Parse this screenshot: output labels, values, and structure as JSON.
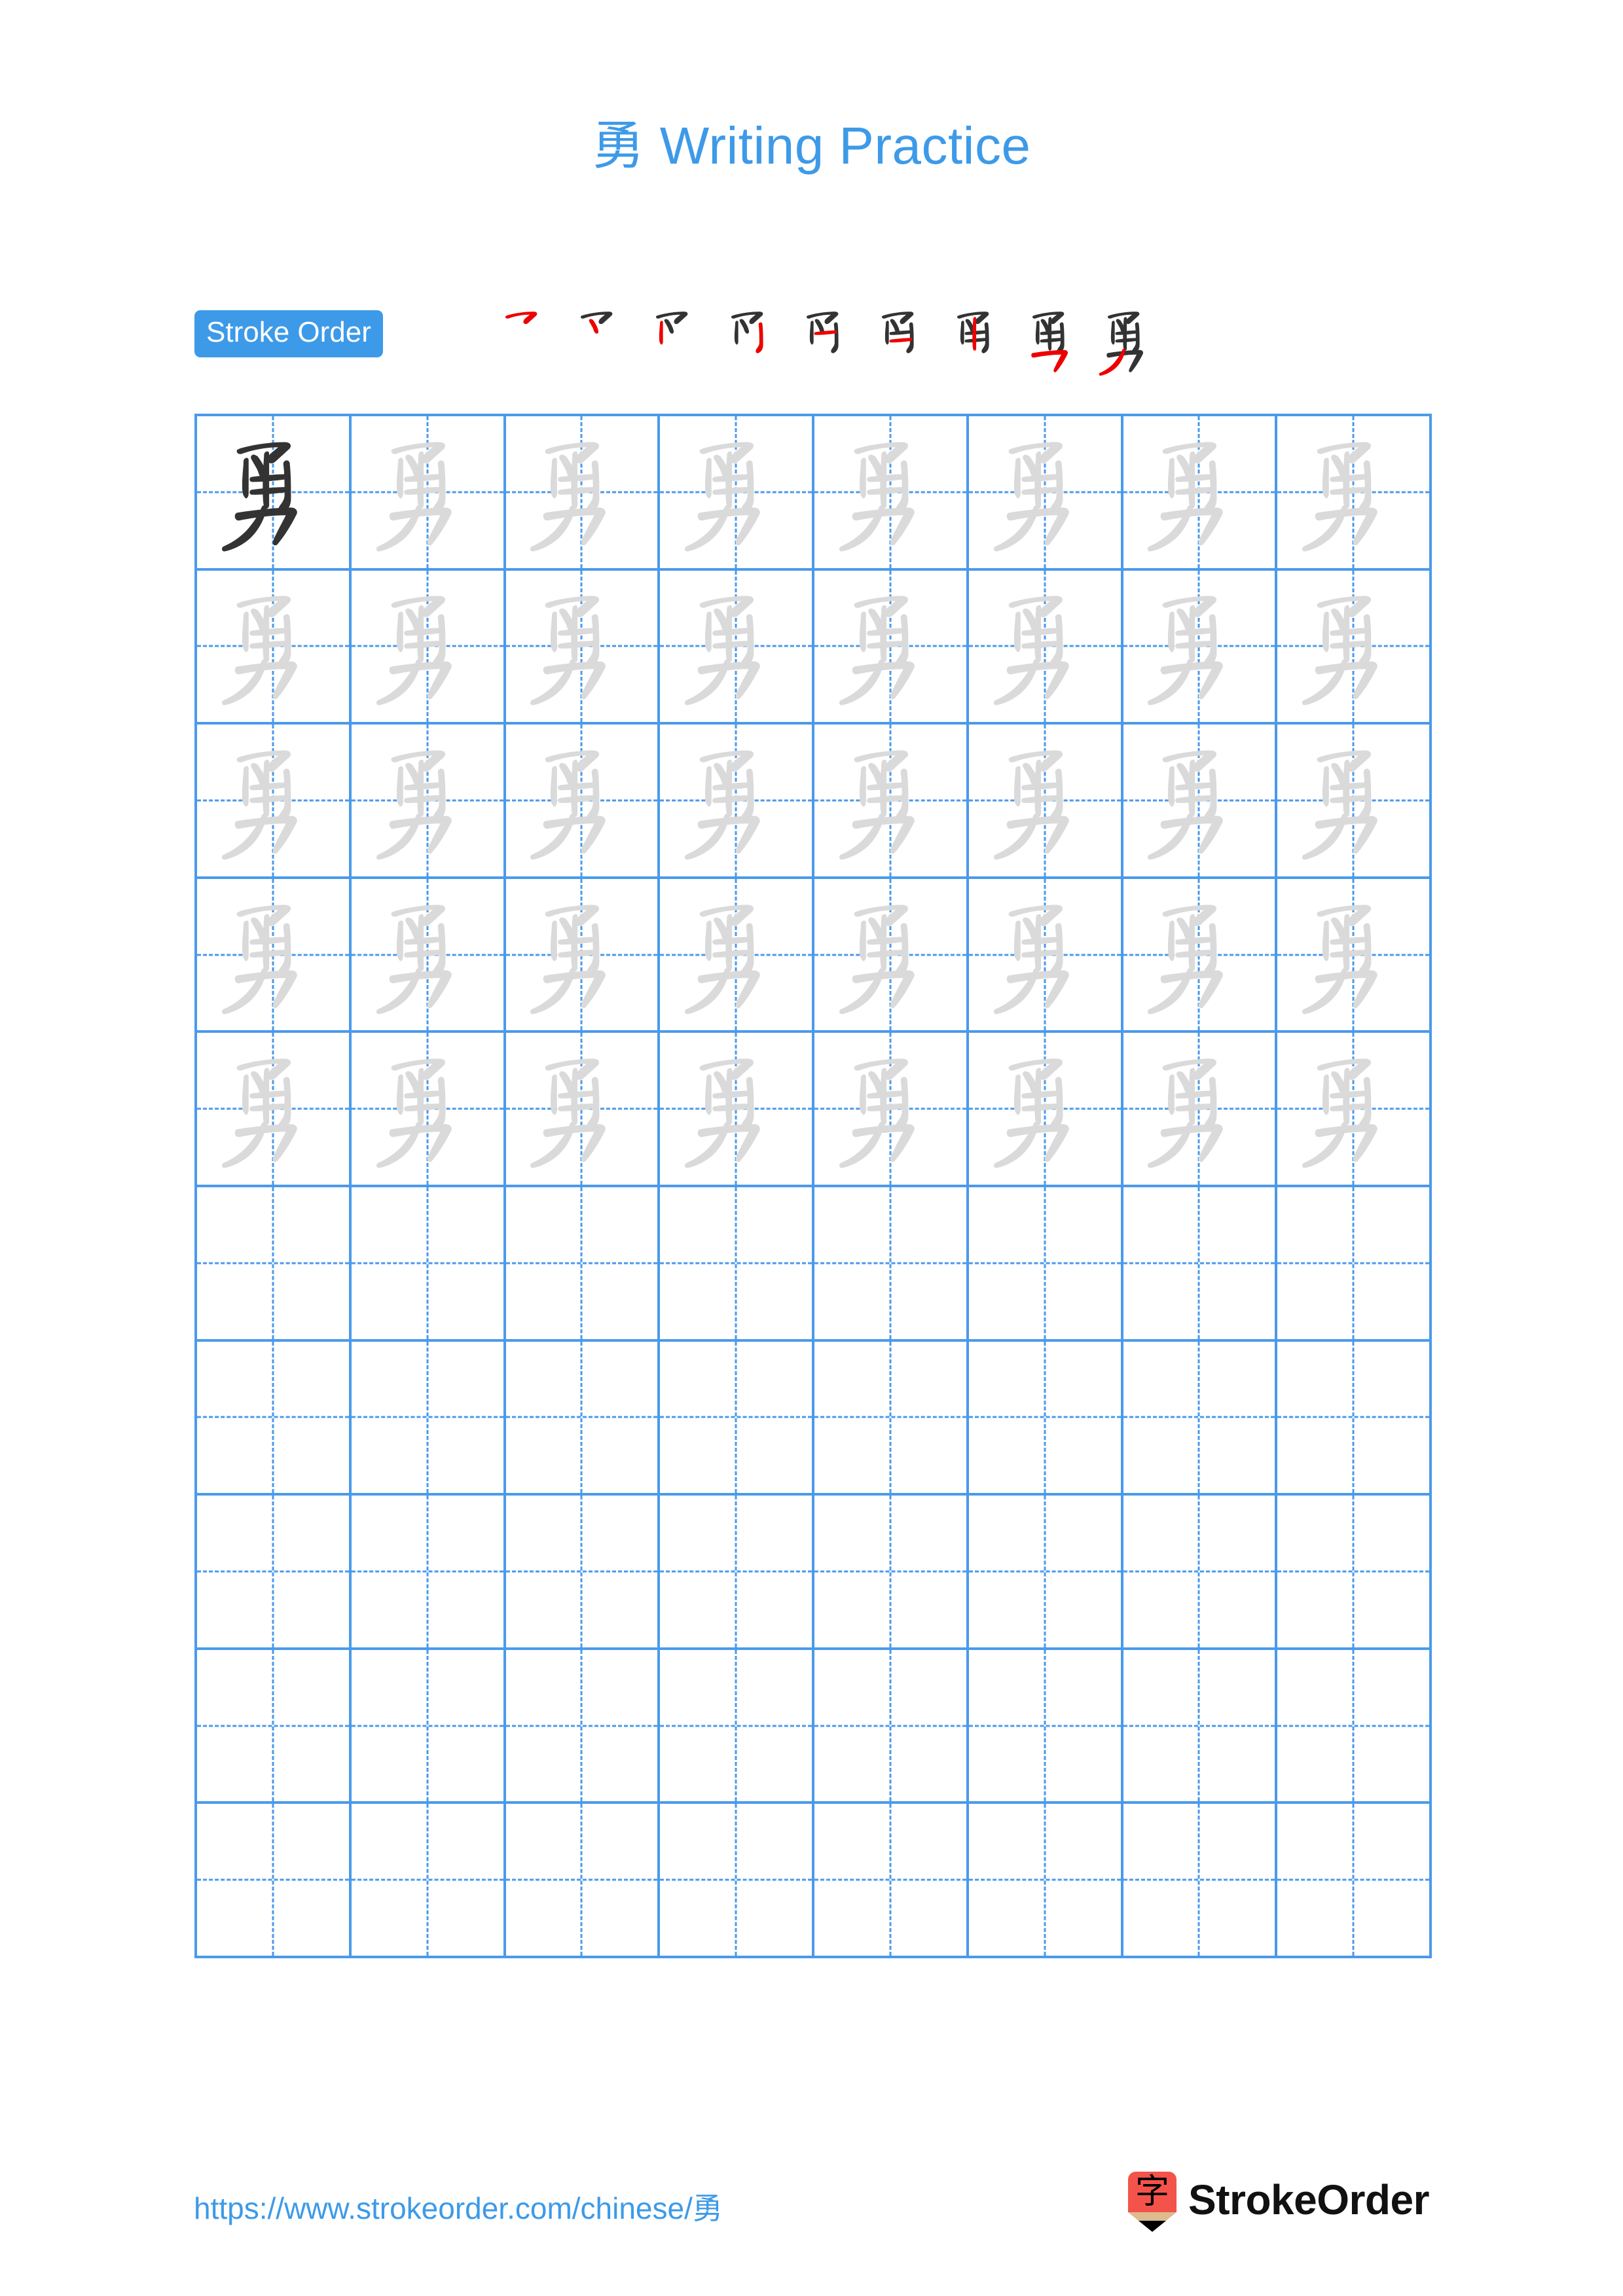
{
  "page": {
    "character": "勇",
    "title_suffix": " Writing Practice",
    "accent_color": "#3d9ae8",
    "grid_line_color": "#4a9aeb",
    "trace_color": "#dadada",
    "model_color": "#333333",
    "stroke_highlight_color": "#ee0000",
    "stroke_done_color": "#333333"
  },
  "stroke_order": {
    "badge_label": "Stroke Order",
    "total_strokes": 9,
    "steps": [
      {
        "index": 1,
        "strokes_shown": 1
      },
      {
        "index": 2,
        "strokes_shown": 2
      },
      {
        "index": 3,
        "strokes_shown": 3
      },
      {
        "index": 4,
        "strokes_shown": 4
      },
      {
        "index": 5,
        "strokes_shown": 5
      },
      {
        "index": 6,
        "strokes_shown": 6
      },
      {
        "index": 7,
        "strokes_shown": 7
      },
      {
        "index": 8,
        "strokes_shown": 8
      },
      {
        "index": 9,
        "strokes_shown": 9
      }
    ]
  },
  "grid": {
    "columns": 8,
    "rows": 10,
    "cells": [
      [
        "model",
        "trace",
        "trace",
        "trace",
        "trace",
        "trace",
        "trace",
        "trace"
      ],
      [
        "trace",
        "trace",
        "trace",
        "trace",
        "trace",
        "trace",
        "trace",
        "trace"
      ],
      [
        "trace",
        "trace",
        "trace",
        "trace",
        "trace",
        "trace",
        "trace",
        "trace"
      ],
      [
        "trace",
        "trace",
        "trace",
        "trace",
        "trace",
        "trace",
        "trace",
        "trace"
      ],
      [
        "trace",
        "trace",
        "trace",
        "trace",
        "trace",
        "trace",
        "trace",
        "trace"
      ],
      [
        "empty",
        "empty",
        "empty",
        "empty",
        "empty",
        "empty",
        "empty",
        "empty"
      ],
      [
        "empty",
        "empty",
        "empty",
        "empty",
        "empty",
        "empty",
        "empty",
        "empty"
      ],
      [
        "empty",
        "empty",
        "empty",
        "empty",
        "empty",
        "empty",
        "empty",
        "empty"
      ],
      [
        "empty",
        "empty",
        "empty",
        "empty",
        "empty",
        "empty",
        "empty",
        "empty"
      ],
      [
        "empty",
        "empty",
        "empty",
        "empty",
        "empty",
        "empty",
        "empty",
        "empty"
      ]
    ]
  },
  "footer": {
    "url": "https://www.strokeorder.com/chinese/勇",
    "brand_name": "StrokeOrder",
    "logo_char": "字",
    "logo_body_color": "#f4534a",
    "logo_wood_color": "#ddbb8f",
    "logo_tip_color": "#000000"
  }
}
